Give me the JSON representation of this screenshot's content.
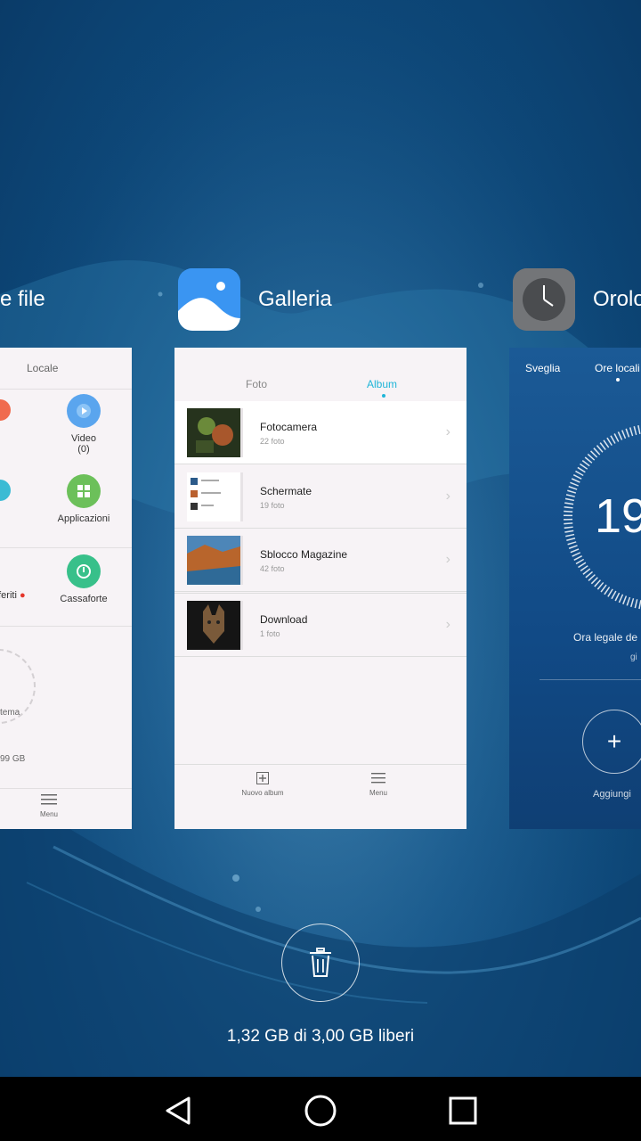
{
  "recents": {
    "files_app": {
      "title_fragment": "e file",
      "tab_label": "Locale",
      "items": {
        "video_label": "Video",
        "video_count": "(0)",
        "apps_label": "Applicazioni",
        "favorites_label": "eferiti",
        "vault_label": "Cassaforte",
        "storage_fragment": "tema",
        "storage_size_fragment": "99 GB"
      },
      "menu_label": "Menu"
    },
    "gallery_app": {
      "title": "Galleria",
      "tabs": [
        "Foto",
        "Album"
      ],
      "active_tab": "Album",
      "albums": [
        {
          "name": "Fotocamera",
          "count": "22 foto"
        },
        {
          "name": "Schermate",
          "count": "19 foto"
        },
        {
          "name": "Sblocco Magazine",
          "count": "42 foto"
        },
        {
          "name": "Download",
          "count": "1 foto"
        }
      ],
      "new_album_label": "Nuovo album",
      "menu_label": "Menu"
    },
    "clock_app": {
      "title_fragment": "Orolo",
      "tabs": [
        "Sveglia",
        "Ore locali"
      ],
      "time_fragment": "19",
      "timezone_fragment": "Ora legale de",
      "sub_fragment": "gi",
      "add_label": "Aggiungi"
    }
  },
  "memory": {
    "free_text": "1,32 GB di 3,00 GB liberi"
  },
  "colors": {
    "accent": "#1fb5d8",
    "nav_bg": "#000000",
    "card_bg": "#f7f3f6"
  }
}
